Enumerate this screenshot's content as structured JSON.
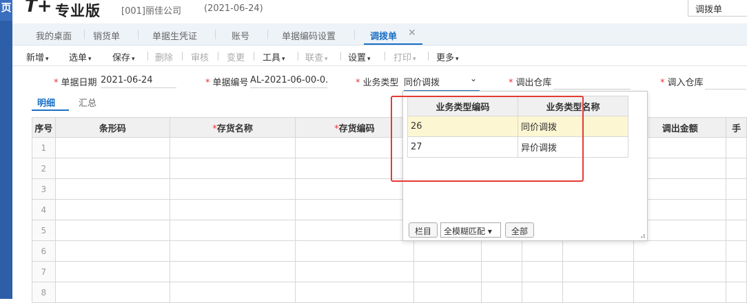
{
  "header": {
    "logo_mark": "T+",
    "product_name": "专业版",
    "company": "[001]丽佳公司",
    "date": "(2021-06-24)",
    "search_value": "调拨单",
    "left_glyph": "页"
  },
  "tabs": [
    {
      "label": "我的桌面"
    },
    {
      "label": "销货单"
    },
    {
      "label": "单据生凭证"
    },
    {
      "label": "账号"
    },
    {
      "label": "单据编码设置"
    },
    {
      "label": "调拨单",
      "active": true
    }
  ],
  "tab_close": "✕",
  "toolbar": {
    "new": "新增",
    "select": "选单",
    "save": "保存",
    "delete": "删除",
    "audit": "审核",
    "change": "变更",
    "tools": "工具",
    "query": "联查",
    "settings": "设置",
    "print": "打印",
    "more": "更多",
    "caret": "▾"
  },
  "form": {
    "date_label": "单据日期",
    "date_value": "2021-06-24",
    "code_label": "单据编号",
    "code_value": "AL-2021-06-00-0...",
    "biztype_label": "业务类型",
    "biztype_value": "同价调拨",
    "out_wh_label": "调出仓库",
    "in_wh_label": "调入仓库",
    "required_mark": "*",
    "dropdown_arrow": "⌄"
  },
  "subtabs": {
    "detail": "明细",
    "summary": "汇总"
  },
  "grid": {
    "headers": {
      "seq": "序号",
      "barcode": "条形码",
      "name": "存货名称",
      "code": "存货编码",
      "amount": "调出金额",
      "cut": "手"
    },
    "rows": [
      "1",
      "2",
      "3",
      "4",
      "5",
      "6",
      "7",
      "8"
    ]
  },
  "popup": {
    "col_code": "业务类型编码",
    "col_name": "业务类型名称",
    "items": [
      {
        "code": "26",
        "name": "同价调拨",
        "selected": true
      },
      {
        "code": "27",
        "name": "异价调拨",
        "selected": false
      }
    ],
    "btn_columns": "栏目",
    "match_mode": "全模糊匹配",
    "btn_all": "全部",
    "resize_glyph": "⠴"
  }
}
